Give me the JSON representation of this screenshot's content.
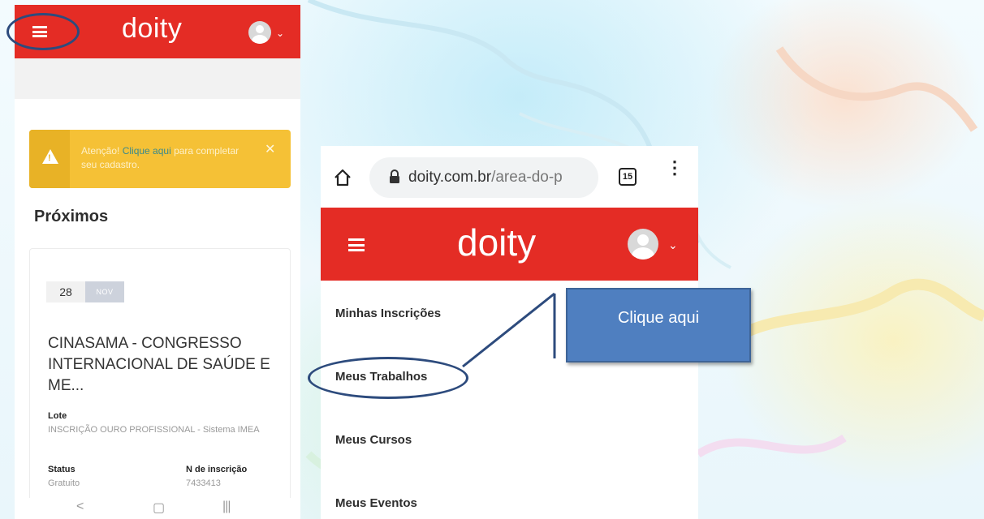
{
  "left_screen": {
    "header": {
      "logo": "doity",
      "menu_icon": "hamburger-menu-icon",
      "avatar_icon": "user-avatar-icon",
      "caret": "⌄"
    },
    "alert": {
      "icon": "warning-icon",
      "text_prefix": "Atenção! ",
      "link_text": "Clique aqui",
      "text_suffix": " para completar seu cadastro.",
      "close": "✕"
    },
    "section_title": "Próximos",
    "event_card": {
      "day": "28",
      "month": "NOV",
      "title": "CINASAMA - CONGRESSO INTERNACIONAL DE SAÚDE E ME...",
      "lote_label": "Lote",
      "lote_value": "INSCRIÇÃO OURO PROFISSIONAL - Sistema IMEA",
      "status_label": "Status",
      "status_value": "Gratuito",
      "registration_label": "N de inscrição",
      "registration_value": "7433413"
    },
    "android_nav": {
      "back": "<",
      "home": "▢",
      "recents": "|||"
    }
  },
  "right_screen": {
    "browser": {
      "home_icon": "home-icon",
      "lock_icon": "lock-icon",
      "url_domain": "doity.com.br",
      "url_path": "/area-do-p",
      "tab_count": "15",
      "menu_icon": "kebab-menu-icon"
    },
    "header": {
      "logo": "doity",
      "caret": "⌄"
    },
    "menu": [
      {
        "label": "Minhas Inscrições"
      },
      {
        "label": "Meus Trabalhos"
      },
      {
        "label": "Meus Cursos"
      },
      {
        "label": "Meus Eventos"
      }
    ]
  },
  "callout": {
    "text": "Clique aqui"
  },
  "colors": {
    "brand_red": "#e42c25",
    "alert_yellow": "#f5c136",
    "annotation_blue": "#2d4b7d",
    "callout_blue": "#4f7fc0"
  }
}
